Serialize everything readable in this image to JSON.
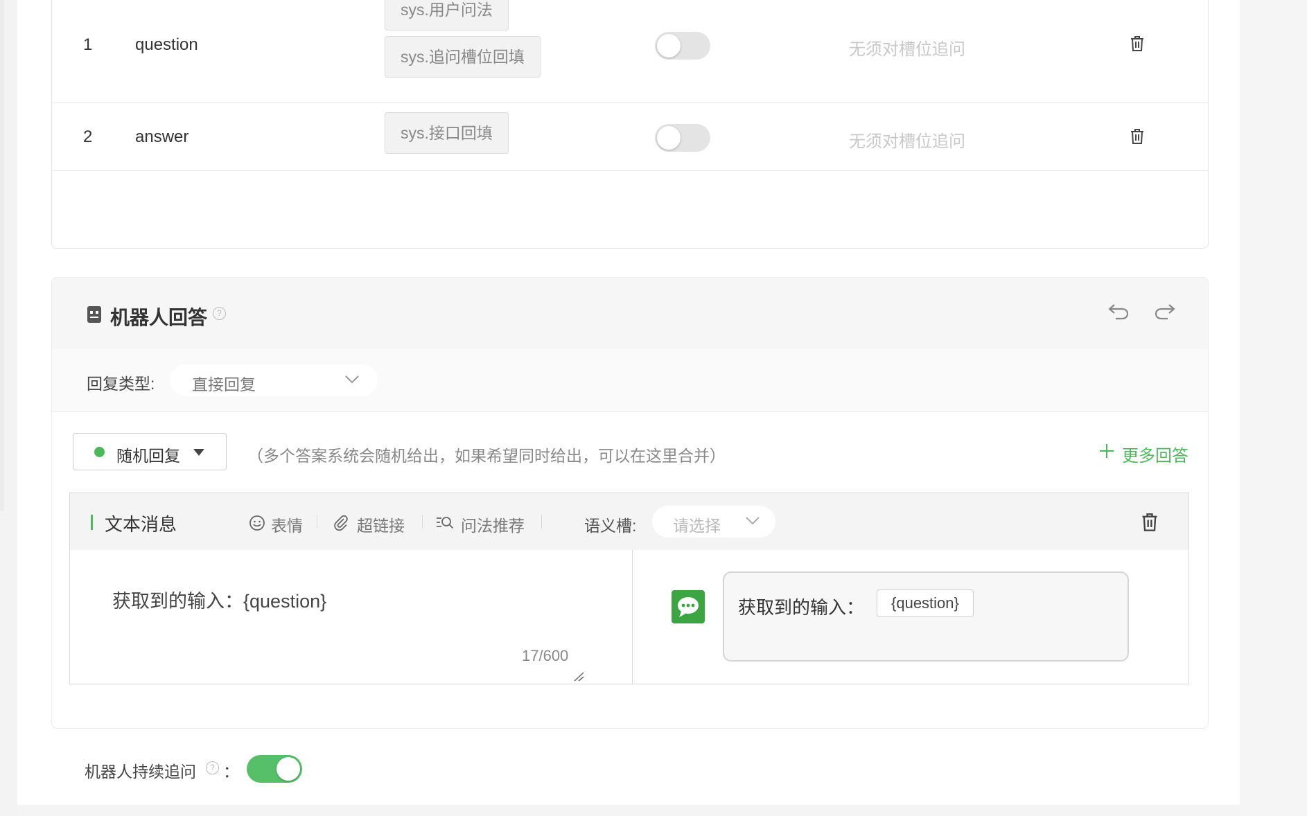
{
  "slots": [
    {
      "index": "1",
      "name": "question",
      "sources": [
        "sys.用户问法",
        "sys.追问槽位回填"
      ],
      "followup": "无须对槽位追问",
      "enabled": false
    },
    {
      "index": "2",
      "name": "answer",
      "sources": [
        "sys.接口回填"
      ],
      "followup": "无须对槽位追问",
      "enabled": false
    }
  ],
  "robot": {
    "title": "机器人回答",
    "help": "?",
    "reply_type_label": "回复类型:",
    "reply_type_value": "直接回复",
    "random_label": "随机回复",
    "hint": "（多个答案系统会随机给出，如果希望同时给出，可以在这里合并）",
    "more_label": "更多回答",
    "more_icon": "+",
    "message": {
      "type_label": "文本消息",
      "tools": [
        "表情",
        "超链接",
        "问法推荐"
      ],
      "slot_label": "语义槽:",
      "slot_placeholder": "请选择",
      "text": "获取到的输入：{question}",
      "counter": "17/600",
      "preview_text": "获取到的输入：",
      "preview_var": "{question}"
    },
    "persist_label": "机器人持续追问",
    "persist_colon": "：",
    "persist_enabled": true
  },
  "colors": {
    "accent": "#55c068",
    "muted": "#c8c8c8",
    "chat_icon": "#3aa541"
  }
}
